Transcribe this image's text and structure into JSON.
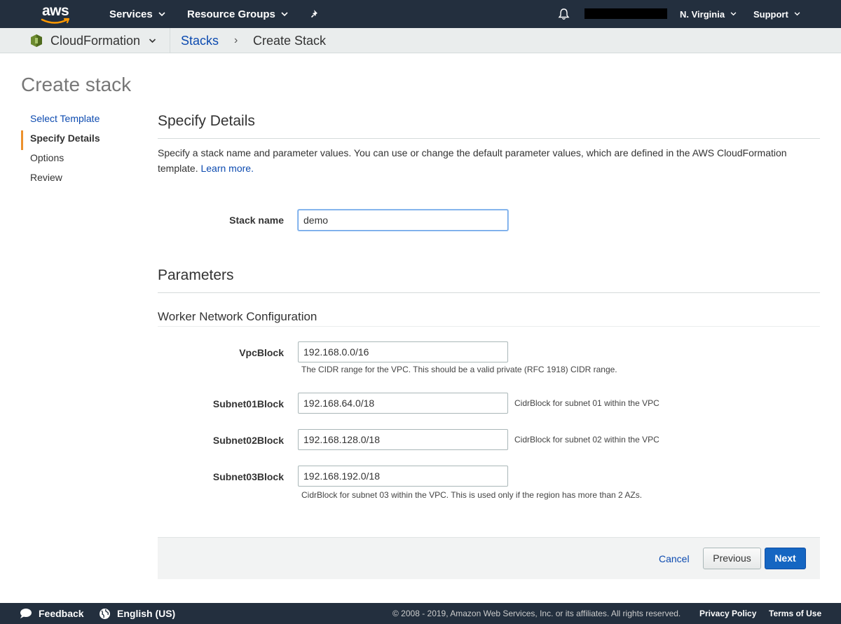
{
  "topnav": {
    "logo": "aws",
    "services": "Services",
    "resource_groups": "Resource Groups",
    "region": "N. Virginia",
    "support": "Support"
  },
  "subnav": {
    "service": "CloudFormation",
    "breadcrumb_link": "Stacks",
    "breadcrumb_sep": "›",
    "breadcrumb_current": "Create Stack"
  },
  "page": {
    "title": "Create stack"
  },
  "steps": [
    {
      "label": "Select Template"
    },
    {
      "label": "Specify Details"
    },
    {
      "label": "Options"
    },
    {
      "label": "Review"
    }
  ],
  "details": {
    "heading": "Specify Details",
    "description": "Specify a stack name and parameter values. You can use or change the default parameter values, which are defined in the AWS CloudFormation template.",
    "learn_more": "Learn more.",
    "stack_name_label": "Stack name",
    "stack_name_value": "demo"
  },
  "parameters": {
    "heading": "Parameters",
    "group": "Worker Network Configuration",
    "items": [
      {
        "label": "VpcBlock",
        "value": "192.168.0.0/16",
        "hint": "The CIDR range for the VPC. This should be a valid private (RFC 1918) CIDR range."
      },
      {
        "label": "Subnet01Block",
        "value": "192.168.64.0/18",
        "hint": "CidrBlock for subnet 01 within the VPC"
      },
      {
        "label": "Subnet02Block",
        "value": "192.168.128.0/18",
        "hint": "CidrBlock for subnet 02 within the VPC"
      },
      {
        "label": "Subnet03Block",
        "value": "192.168.192.0/18",
        "hint": "CidrBlock for subnet 03 within the VPC. This is used only if the region has more than 2 AZs."
      }
    ]
  },
  "actions": {
    "cancel": "Cancel",
    "previous": "Previous",
    "next": "Next"
  },
  "footer": {
    "feedback": "Feedback",
    "language": "English (US)",
    "copyright": "© 2008 - 2019, Amazon Web Services, Inc. or its affiliates. All rights reserved.",
    "privacy": "Privacy Policy",
    "terms": "Terms of Use"
  },
  "colors": {
    "nav_bg": "#232f3e",
    "link": "#0d4bb0",
    "active_step": "#ec912d",
    "primary_button": "#1566c2",
    "logo_smile": "#ff9900"
  }
}
